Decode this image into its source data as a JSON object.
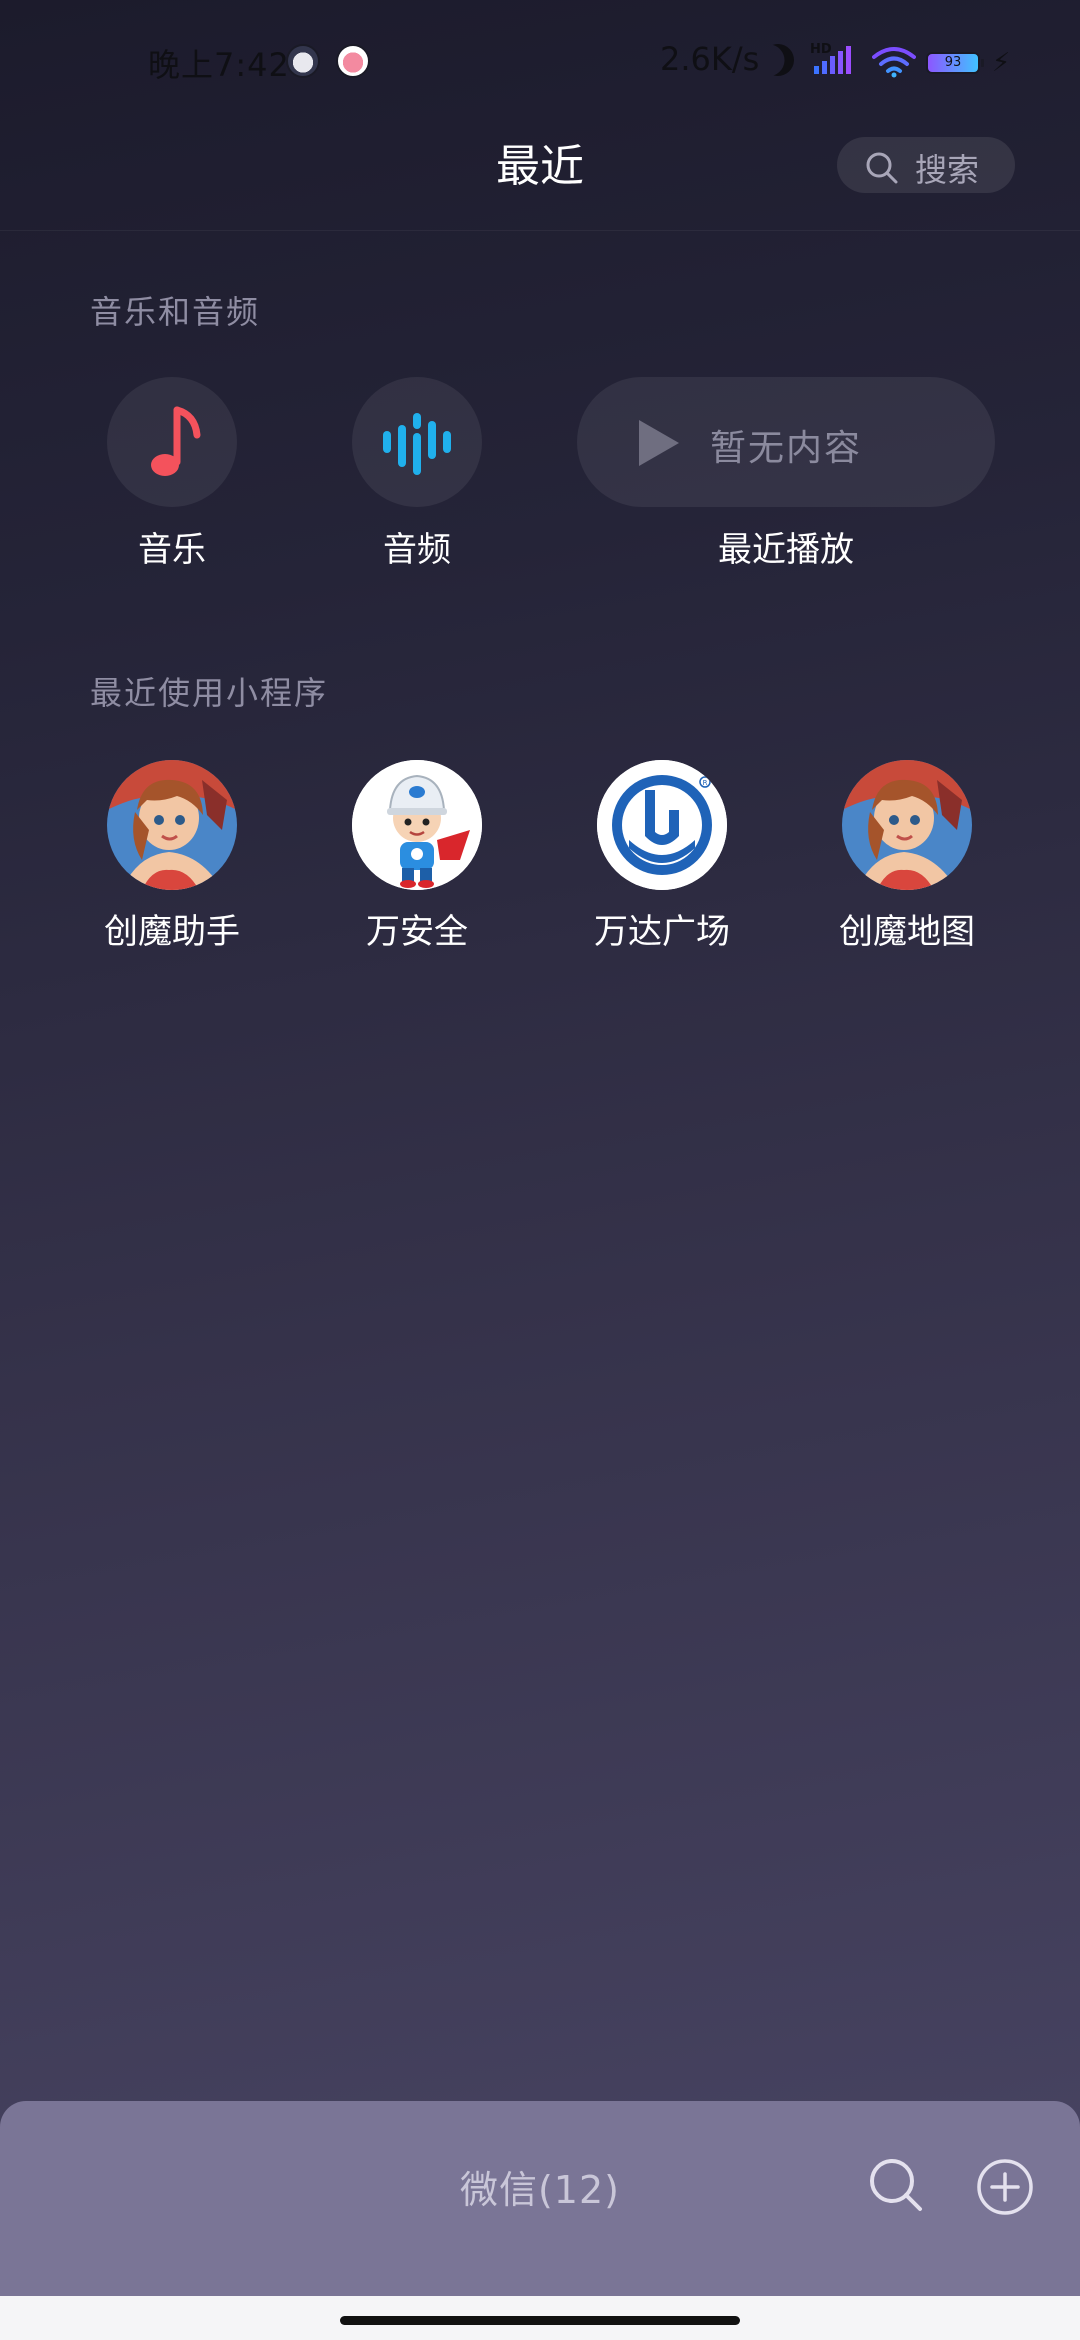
{
  "status_bar": {
    "time": "晚上7:42",
    "net_speed": "2.6K/s",
    "network_label": "HD",
    "battery": "93"
  },
  "header": {
    "title": "最近",
    "search_label": "搜索"
  },
  "media_section": {
    "title": "音乐和音频",
    "items": [
      {
        "label": "音乐",
        "icon": "music-note-icon"
      },
      {
        "label": "音频",
        "icon": "audio-wave-icon"
      }
    ],
    "recent_play": {
      "label": "最近播放",
      "empty_text": "暂无内容",
      "icon": "play-icon"
    }
  },
  "mini_programs": {
    "title": "最近使用小程序",
    "items": [
      {
        "label": "创魔助手",
        "icon": "anime-girl-avatar"
      },
      {
        "label": "万安全",
        "icon": "safety-worker-avatar"
      },
      {
        "label": "万达广场",
        "icon": "wanda-logo"
      },
      {
        "label": "创魔地图",
        "icon": "anime-girl-avatar"
      }
    ]
  },
  "bottom_bar": {
    "title": "微信(12)"
  },
  "colors": {
    "music_red": "#f4525c",
    "audio_blue": "#20b0ec",
    "wanda_blue": "#1f63b8",
    "bottom_panel": "#7a7596"
  }
}
